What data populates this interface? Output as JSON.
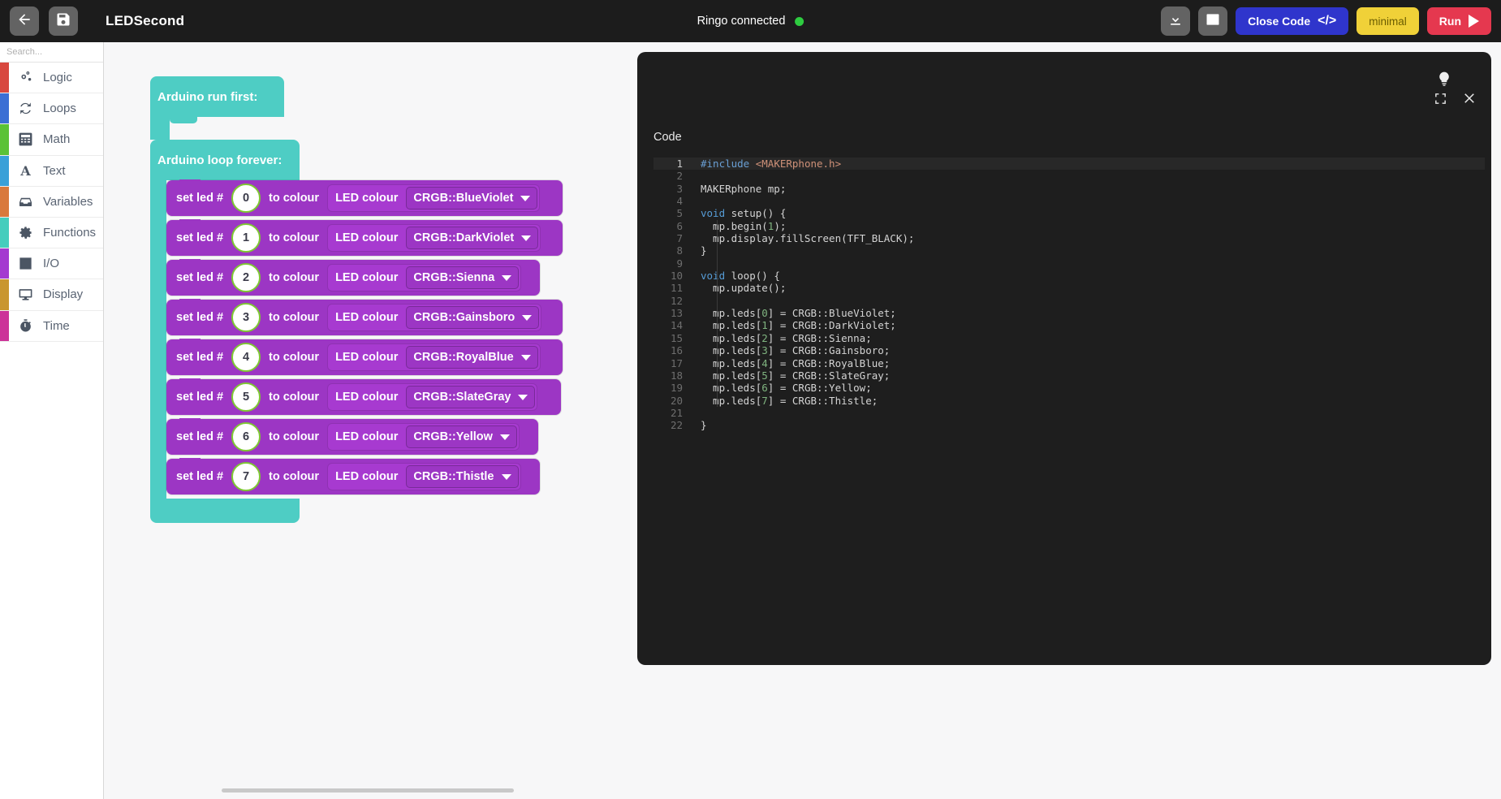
{
  "topbar": {
    "back_icon": "arrow-left-icon",
    "save_icon": "floppy-disk-icon",
    "project_title": "LEDSecond",
    "connection_label": "Ringo connected",
    "download_icon": "download-icon",
    "panel_icon": "bottom-panel-icon",
    "close_code_label": "Close Code",
    "code_chevrons": "</>",
    "minimal_label": "minimal",
    "run_label": "Run",
    "colors": {
      "bar_bg": "#1c1c1c",
      "close_code": "#2f35cc",
      "minimal": "#f0d138",
      "run": "#e5384f",
      "connected_dot": "#2ecc40"
    }
  },
  "sidebar": {
    "search": {
      "placeholder": "Search...",
      "value": "",
      "icon": "search-icon"
    },
    "items": [
      {
        "label": "Logic",
        "icon": "gears-icon",
        "color": "#d8483f"
      },
      {
        "label": "Loops",
        "icon": "refresh-icon",
        "color": "#3b6fd4"
      },
      {
        "label": "Math",
        "icon": "calculator-icon",
        "color": "#5bc236"
      },
      {
        "label": "Text",
        "icon": "letter-a-icon",
        "color": "#3aa0d8"
      },
      {
        "label": "Variables",
        "icon": "inbox-icon",
        "color": "#d9793c"
      },
      {
        "label": "Functions",
        "icon": "gear-icon",
        "color": "#45cdbd"
      },
      {
        "label": "I/O",
        "icon": "arrow-box-icon",
        "color": "#a43ad0"
      },
      {
        "label": "Display",
        "icon": "monitor-icon",
        "color": "#c9962f"
      },
      {
        "label": "Time",
        "icon": "stopwatch-icon",
        "color": "#cc3399"
      }
    ]
  },
  "canvas": {
    "setup_block_label": "Arduino run first:",
    "loop_block_label": "Arduino loop forever:",
    "statement_prefix": "set led #",
    "statement_middle": "to colour",
    "inner_block_label": "LED colour",
    "statements": [
      {
        "index": "0",
        "colour": "CRGB::BlueViolet"
      },
      {
        "index": "1",
        "colour": "CRGB::DarkViolet"
      },
      {
        "index": "2",
        "colour": "CRGB::Sienna"
      },
      {
        "index": "3",
        "colour": "CRGB::Gainsboro"
      },
      {
        "index": "4",
        "colour": "CRGB::RoyalBlue"
      },
      {
        "index": "5",
        "colour": "CRGB::SlateGray"
      },
      {
        "index": "6",
        "colour": "CRGB::Yellow"
      },
      {
        "index": "7",
        "colour": "CRGB::Thistle"
      }
    ],
    "zoom_controls": {
      "center_icon": "crosshair-icon",
      "zoom_in_label": "+",
      "zoom_out_label": "−"
    },
    "colors": {
      "event_block": "#4ecdc4",
      "statement_block": "#9c36c4",
      "number_ring": "#7ec832"
    }
  },
  "code_panel": {
    "title": "Code",
    "bulb_icon": "lightbulb-icon",
    "expand_icon": "fullscreen-icon",
    "close_icon": "close-icon",
    "lines": [
      {
        "n": "1",
        "text": "#include <MAKERphone.h>"
      },
      {
        "n": "2",
        "text": ""
      },
      {
        "n": "3",
        "text": "MAKERphone mp;"
      },
      {
        "n": "4",
        "text": ""
      },
      {
        "n": "5",
        "text": "void setup() {"
      },
      {
        "n": "6",
        "text": "  mp.begin(1);"
      },
      {
        "n": "7",
        "text": "  mp.display.fillScreen(TFT_BLACK);"
      },
      {
        "n": "8",
        "text": "}"
      },
      {
        "n": "9",
        "text": ""
      },
      {
        "n": "10",
        "text": "void loop() {"
      },
      {
        "n": "11",
        "text": "  mp.update();"
      },
      {
        "n": "12",
        "text": ""
      },
      {
        "n": "13",
        "text": "  mp.leds[0] = CRGB::BlueViolet;"
      },
      {
        "n": "14",
        "text": "  mp.leds[1] = CRGB::DarkViolet;"
      },
      {
        "n": "15",
        "text": "  mp.leds[2] = CRGB::Sienna;"
      },
      {
        "n": "16",
        "text": "  mp.leds[3] = CRGB::Gainsboro;"
      },
      {
        "n": "17",
        "text": "  mp.leds[4] = CRGB::RoyalBlue;"
      },
      {
        "n": "18",
        "text": "  mp.leds[5] = CRGB::SlateGray;"
      },
      {
        "n": "19",
        "text": "  mp.leds[6] = CRGB::Yellow;"
      },
      {
        "n": "20",
        "text": "  mp.leds[7] = CRGB::Thistle;"
      },
      {
        "n": "21",
        "text": ""
      },
      {
        "n": "22",
        "text": "}"
      }
    ]
  }
}
